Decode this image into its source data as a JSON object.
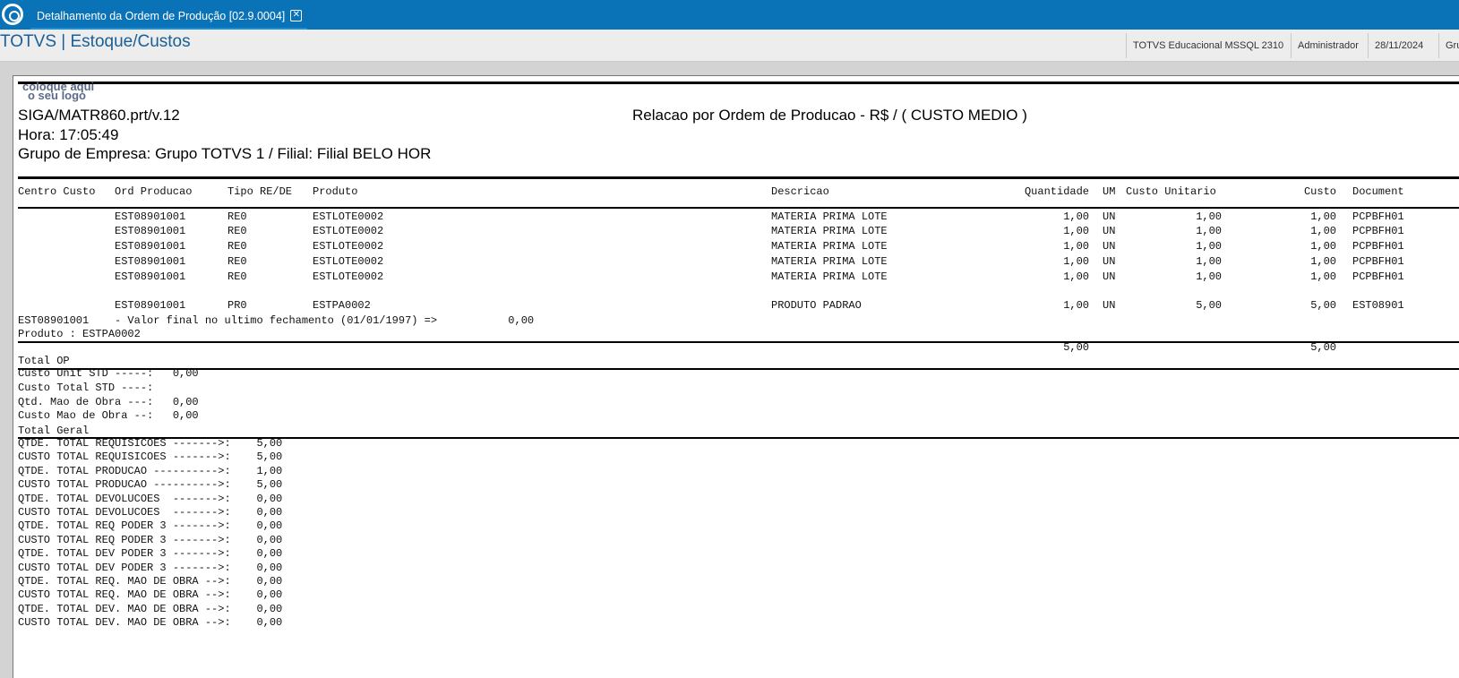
{
  "window": {
    "tab_title": "Detalhamento da Ordem de Produção [02.9.0004]",
    "close_symbol": "✕"
  },
  "header": {
    "app_title": "TOTVS | Estoque/Custos",
    "environment": "TOTVS Educacional MSSQL 2310",
    "user": "Administrador",
    "date": "28/11/2024",
    "group_partial": "Gru"
  },
  "report": {
    "logo_line1": "coloque aqui",
    "logo_line2": "o seu logo",
    "program": "SIGA/MATR860.prt/v.12",
    "title": "Relacao por Ordem de Producao - R$ / ( CUSTO MEDIO )",
    "time": "Hora: 17:05:49",
    "company": "Grupo de Empresa: Grupo TOTVS 1 / Filial: Filial BELO HOR",
    "columns": [
      "Centro Custo",
      "Ord Producao",
      "Tipo RE/DE",
      "Produto",
      "Descricao",
      "Quantidade",
      "UM",
      "Custo Unitario",
      "Custo",
      "Document"
    ],
    "rows": [
      {
        "op": "EST08901001",
        "tipo": "RE0",
        "produto": "ESTLOTE0002",
        "descricao": "MATERIA PRIMA LOTE",
        "quantidade": "1,00",
        "um": "UN",
        "custo_unit": "1,00",
        "custo": "1,00",
        "documento": "PCPBFH01"
      },
      {
        "op": "EST08901001",
        "tipo": "RE0",
        "produto": "ESTLOTE0002",
        "descricao": "MATERIA PRIMA LOTE",
        "quantidade": "1,00",
        "um": "UN",
        "custo_unit": "1,00",
        "custo": "1,00",
        "documento": "PCPBFH01"
      },
      {
        "op": "EST08901001",
        "tipo": "RE0",
        "produto": "ESTLOTE0002",
        "descricao": "MATERIA PRIMA LOTE",
        "quantidade": "1,00",
        "um": "UN",
        "custo_unit": "1,00",
        "custo": "1,00",
        "documento": "PCPBFH01"
      },
      {
        "op": "EST08901001",
        "tipo": "RE0",
        "produto": "ESTLOTE0002",
        "descricao": "MATERIA PRIMA LOTE",
        "quantidade": "1,00",
        "um": "UN",
        "custo_unit": "1,00",
        "custo": "1,00",
        "documento": "PCPBFH01"
      },
      {
        "op": "EST08901001",
        "tipo": "RE0",
        "produto": "ESTLOTE0002",
        "descricao": "MATERIA PRIMA LOTE",
        "quantidade": "1,00",
        "um": "UN",
        "custo_unit": "1,00",
        "custo": "1,00",
        "documento": "PCPBFH01"
      }
    ],
    "production_row": {
      "op": "EST08901001",
      "tipo": "PR0",
      "produto": "ESTPA0002",
      "descricao": "PRODUTO PADRAO",
      "quantidade": "1,00",
      "um": "UN",
      "custo_unit": "5,00",
      "custo": "5,00",
      "documento": "EST08901"
    },
    "final_value_line": "EST08901001    - Valor final no ultimo fechamento (01/01/1997) =>           0,00",
    "product_line": "Produto : ESTPA0002",
    "totals_quantidade": "5,00",
    "totals_custo": "5,00",
    "total_op_label": "Total OP",
    "std_lines": [
      "Custo Unit STD -----:   0,00",
      "Custo Total STD ----:",
      "Qtd. Mao de Obra ---:   0,00",
      "Custo Mao de Obra --:   0,00"
    ],
    "total_geral_label": "Total Geral",
    "geral_lines": [
      "QTDE. TOTAL REQUISICOES ------->:    5,00",
      "CUSTO TOTAL REQUISICOES ------->:    5,00",
      "QTDE. TOTAL PRODUCAO ---------->:    1,00",
      "CUSTO TOTAL PRODUCAO ---------->:    5,00",
      "QTDE. TOTAL DEVOLUCOES  ------->:    0,00",
      "CUSTO TOTAL DEVOLUCOES  ------->:    0,00",
      "QTDE. TOTAL REQ PODER 3 ------->:    0,00",
      "CUSTO TOTAL REQ PODER 3 ------->:    0,00",
      "QTDE. TOTAL DEV PODER 3 ------->:    0,00",
      "CUSTO TOTAL DEV PODER 3 ------->:    0,00",
      "QTDE. TOTAL REQ. MAO DE OBRA -->:    0,00",
      "CUSTO TOTAL REQ. MAO DE OBRA -->:    0,00",
      "QTDE. TOTAL DEV. MAO DE OBRA -->:    0,00",
      "CUSTO TOTAL DEV. MAO DE OBRA -->:    0,00"
    ]
  }
}
